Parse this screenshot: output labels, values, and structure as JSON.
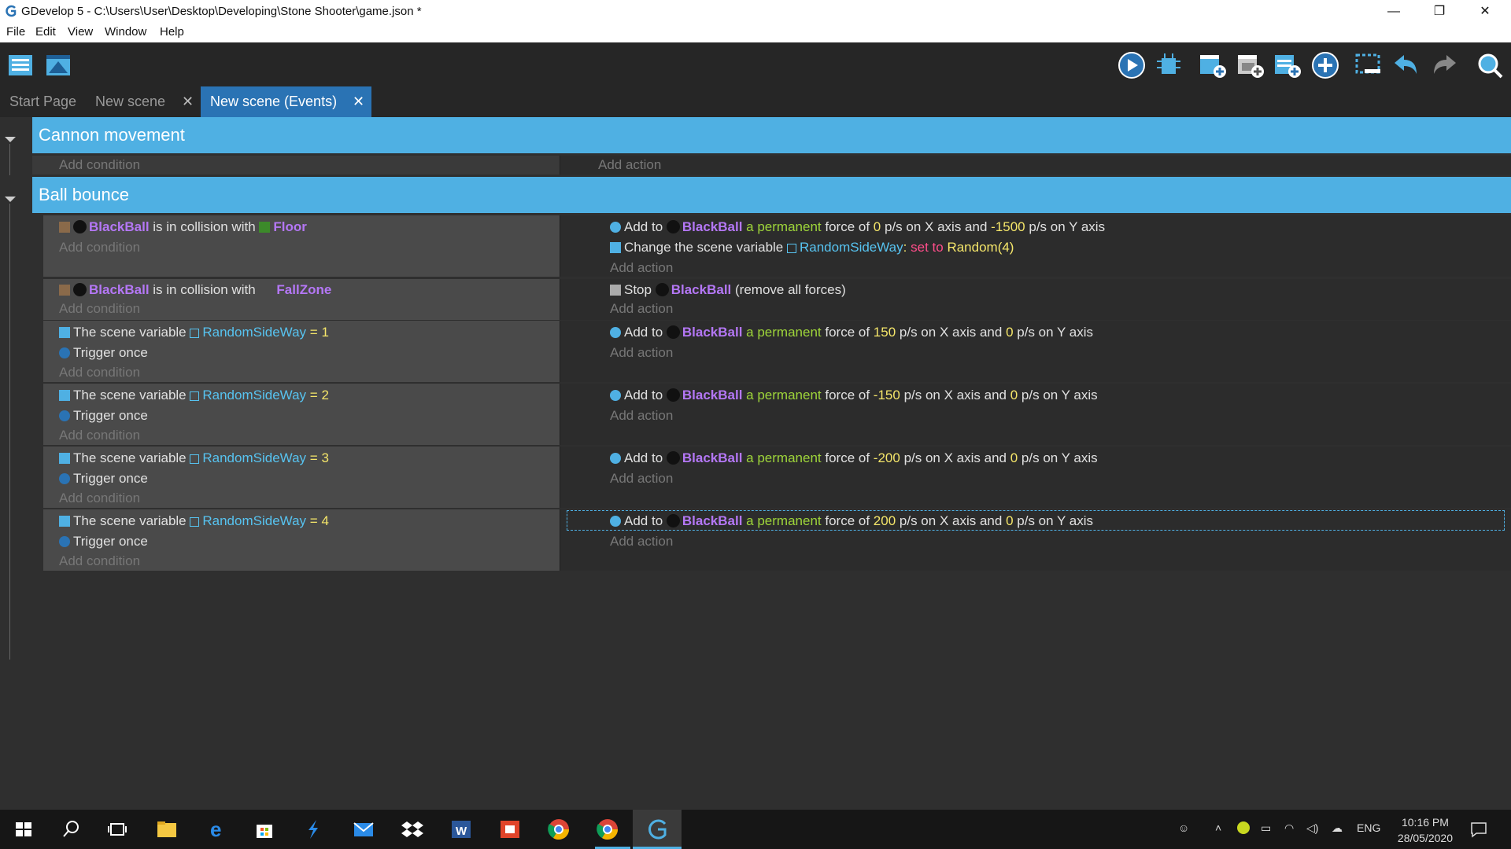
{
  "window": {
    "title": "GDevelop 5 - C:\\Users\\User\\Desktop\\Developing\\Stone Shooter\\game.json *",
    "minimize": "—",
    "maximize": "❐",
    "close": "✕"
  },
  "menu": [
    "File",
    "Edit",
    "View",
    "Window",
    "Help"
  ],
  "toolbar": {
    "left_icons": [
      "project-manager-icon",
      "scene-editor-icon"
    ],
    "right_icons": [
      "preview-play-icon",
      "debugger-icon",
      "add-event-icon",
      "add-subevent-icon",
      "add-comment-icon",
      "add-other-icon",
      "delete-icon",
      "undo-icon",
      "redo-icon",
      "search-icon"
    ]
  },
  "tabs": [
    {
      "label": "Start Page"
    },
    {
      "label": "New scene",
      "close": "✕"
    },
    {
      "label": "New scene (Events)",
      "close": "✕",
      "active": true
    }
  ],
  "events": {
    "groups": [
      {
        "title": "Cannon movement"
      },
      {
        "title": "Ball bounce"
      }
    ],
    "add_condition": "Add condition",
    "add_action": "Add action",
    "e1": {
      "c_obj": "BlackBall",
      "c_text": "is in collision with",
      "c_obj2": "Floor",
      "a1_pre": "Add to",
      "a1_obj": "BlackBall",
      "a1_perm": "a permanent",
      "a1_t1": "force of",
      "a1_x": "0",
      "a1_t2": "p/s on X axis and",
      "a1_y": "-1500",
      "a1_t3": "p/s on Y axis",
      "a2_pre": "Change the scene variable",
      "a2_var": "RandomSideWay",
      "a2_colon": ":",
      "a2_set": "set to",
      "a2_val": "Random(4)"
    },
    "e2": {
      "c_obj": "BlackBall",
      "c_text": "is in collision with",
      "c_obj2": "FallZone",
      "a1_pre": "Stop",
      "a1_obj": "BlackBall",
      "a1_post": "(remove all forces)"
    },
    "scene_var_text": "The scene variable",
    "var_name": "RandomSideWay",
    "eq": "=",
    "trigger_once": "Trigger once",
    "add_to": "Add to",
    "obj": "BlackBall",
    "perm": "a permanent",
    "force_of": "force of",
    "on_x_and": "p/s on X axis and",
    "on_y": "p/s on Y axis",
    "e3": {
      "val": "1",
      "fx": "150",
      "fy": "0"
    },
    "e4": {
      "val": "2",
      "fx": "-150",
      "fy": "0"
    },
    "e5": {
      "val": "3",
      "fx": "-200",
      "fy": "0"
    },
    "e6": {
      "val": "4",
      "fx": "200",
      "fy": "0"
    }
  },
  "taskbar": {
    "apps": [
      "windows-start-icon",
      "search-icon",
      "task-view-icon",
      "file-explorer-icon",
      "edge-icon",
      "store-icon",
      "visual-studio-icon",
      "mail-icon",
      "dropbox-icon",
      "word-icon",
      "office-icon",
      "chrome-icon",
      "chrome-profile-icon",
      "gdevelop-icon"
    ],
    "lang": "ENG",
    "time": "10:16 PM",
    "date": "28/05/2020"
  }
}
